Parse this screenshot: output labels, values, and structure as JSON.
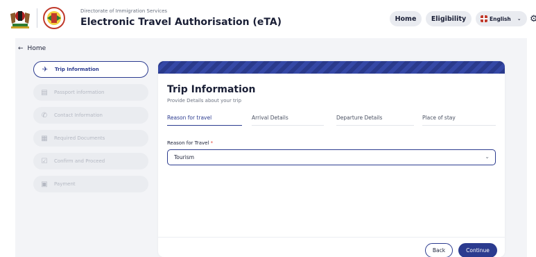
{
  "header": {
    "subtitle": "Directorate of Immigration Services",
    "title": "Electronic Travel Authorisation (eTA)",
    "nav": {
      "home": "Home",
      "eligibility": "Eligibility",
      "language": "English"
    }
  },
  "back_link": "Home",
  "sidebar": {
    "items": [
      {
        "label": "Trip Information",
        "icon": "plane-icon",
        "active": true
      },
      {
        "label": "Passport information",
        "icon": "passport-icon",
        "active": false
      },
      {
        "label": "Contact Information",
        "icon": "phone-icon",
        "active": false
      },
      {
        "label": "Required Documents",
        "icon": "document-icon",
        "active": false
      },
      {
        "label": "Confirm and Proceed",
        "icon": "checkbox-icon",
        "active": false
      },
      {
        "label": "Payment",
        "icon": "wallet-icon",
        "active": false
      }
    ]
  },
  "card": {
    "title": "Trip Information",
    "subtitle": "Provide Details about your trip",
    "tabs": [
      {
        "label": "Reason for travel",
        "active": true
      },
      {
        "label": "Arrival Details",
        "active": false
      },
      {
        "label": "Departure Details",
        "active": false
      },
      {
        "label": "Place of stay",
        "active": false
      }
    ],
    "field_label": "Reason for Travel",
    "required_marker": "*",
    "field_value": "Tourism",
    "back_button": "Back",
    "continue_button": "Continue"
  },
  "colors": {
    "accent": "#2b3b8f",
    "required": "#e0483e",
    "background": "#f3f4f7"
  }
}
